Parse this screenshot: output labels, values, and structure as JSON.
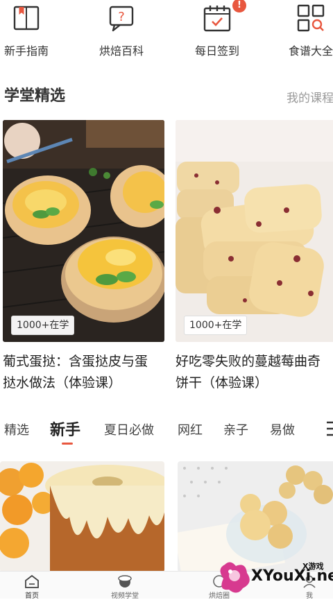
{
  "quick_entries": [
    {
      "label": "新手指南",
      "icon": "book-bookmark-icon"
    },
    {
      "label": "烘焙百科",
      "icon": "question-bubble-icon"
    },
    {
      "label": "每日签到",
      "icon": "calendar-check-icon",
      "badge": "!"
    },
    {
      "label": "食谱大全",
      "icon": "grid-search-icon"
    }
  ],
  "section": {
    "title": "学堂精选",
    "more_link": "我的课程"
  },
  "featured_courses": [
    {
      "title": "葡式蛋挞：含蛋挞皮与蛋挞水做法（体验课）",
      "learners": "1000+在学",
      "image": "egg-tart-photo"
    },
    {
      "title": "好吃零失败的蔓越莓曲奇饼干（体验课）",
      "learners": "1000+在学",
      "image": "cranberry-cookie-photo"
    }
  ],
  "tabs": [
    "精选",
    "新手",
    "夏日必做",
    "网红",
    "亲子",
    "易做"
  ],
  "active_tab": "新手",
  "recipe_previews": [
    {
      "image": "orange-chiffon-cake-photo"
    },
    {
      "image": "butter-cookies-photo"
    }
  ],
  "bottom_nav": [
    {
      "label": "首页",
      "icon": "home-icon",
      "active": true
    },
    {
      "label": "视频学堂",
      "icon": "chef-hat-icon",
      "active": false
    },
    {
      "label": "烘焙圈",
      "icon": "circle-icon",
      "active": false
    },
    {
      "label": "我",
      "icon": "user-icon",
      "active": false
    }
  ],
  "watermark": {
    "small": "X游戏",
    "text": "XYouXi.net"
  },
  "colors": {
    "accent": "#e8573f",
    "text": "#222222",
    "muted": "#999999"
  }
}
